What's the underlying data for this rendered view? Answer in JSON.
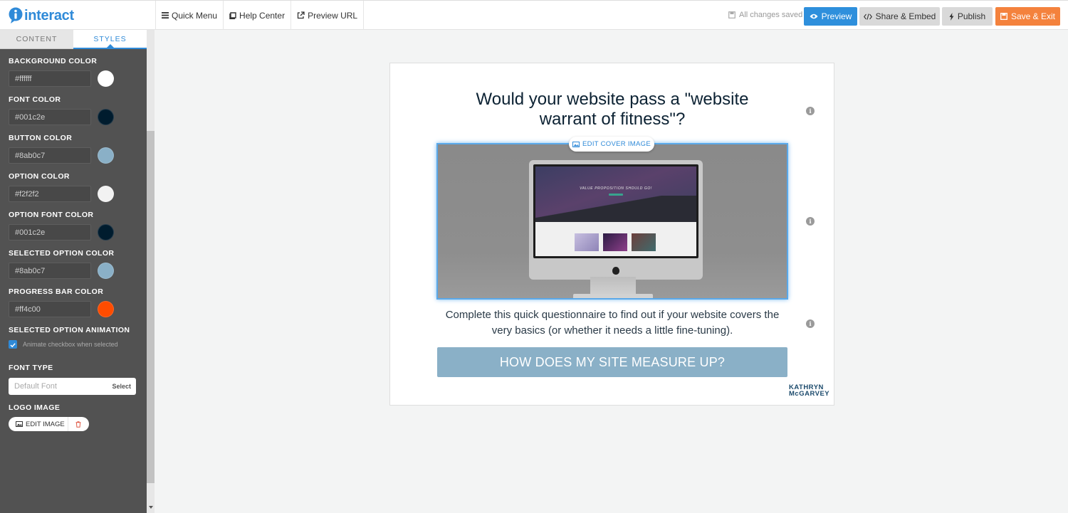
{
  "header": {
    "logo_text": "interact",
    "nav": {
      "quick_menu": "Quick Menu",
      "help_center": "Help Center",
      "preview_url": "Preview URL"
    },
    "status": "All changes saved",
    "buttons": {
      "preview": "Preview",
      "share": "Share & Embed",
      "publish": "Publish",
      "save_exit": "Save & Exit"
    }
  },
  "sidebar": {
    "tabs": {
      "content": "CONTENT",
      "styles": "STYLES"
    },
    "colors": [
      {
        "label": "BACKGROUND COLOR",
        "value": "#ffffff",
        "swatch": "#ffffff"
      },
      {
        "label": "FONT COLOR",
        "value": "#001c2e",
        "swatch": "#001c2e"
      },
      {
        "label": "BUTTON COLOR",
        "value": "#8ab0c7",
        "swatch": "#8ab0c7"
      },
      {
        "label": "OPTION COLOR",
        "value": "#f2f2f2",
        "swatch": "#f2f2f2"
      },
      {
        "label": "OPTION FONT COLOR",
        "value": "#001c2e",
        "swatch": "#001c2e"
      },
      {
        "label": "SELECTED OPTION COLOR",
        "value": "#8ab0c7",
        "swatch": "#8ab0c7"
      },
      {
        "label": "PROGRESS BAR COLOR",
        "value": "#ff4c00",
        "swatch": "#ff4c00"
      }
    ],
    "animation": {
      "label": "SELECTED OPTION ANIMATION",
      "checkbox_label": "Animate checkbox when selected",
      "checked": true
    },
    "font_type": {
      "label": "FONT TYPE",
      "placeholder": "Default Font",
      "select": "Select"
    },
    "logo_image": {
      "label": "LOGO IMAGE",
      "edit": "EDIT IMAGE"
    }
  },
  "canvas": {
    "title": "Would your website pass a \"website warrant of fitness\"?",
    "edit_cover": "EDIT COVER IMAGE",
    "description": "Complete this quick questionnaire to find out if your website covers the very basics (or whether it needs a little fine-tuning).",
    "cta": "HOW DOES MY SITE MEASURE UP?",
    "brand_line1": "KATHRYN",
    "brand_line2": "McGARVEY",
    "screen_text": "VALUE PROPOSITION SHOULD GO!"
  }
}
